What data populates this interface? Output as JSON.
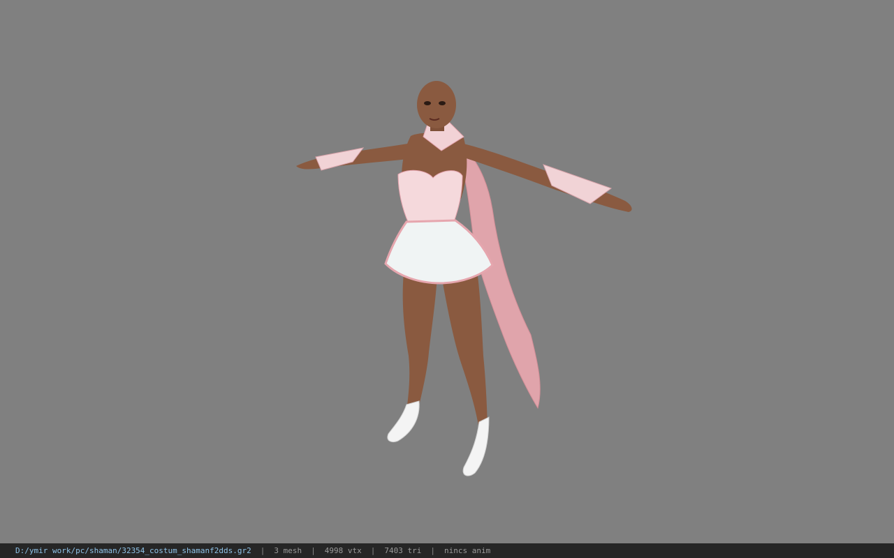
{
  "viewport": {
    "subject": "character-model-preview",
    "background_color": "#808080"
  },
  "status_bar": {
    "file_path": "D:/ymir work/pc/shaman/32354_costum_shamanf2dds.gr2",
    "separator": "|",
    "mesh": "3 mesh",
    "vertices": "4998 vtx",
    "triangles": "7403 tri",
    "animation": "nincs anim",
    "path_color": "#8fc3e8",
    "text_color": "#9a9a9a"
  }
}
